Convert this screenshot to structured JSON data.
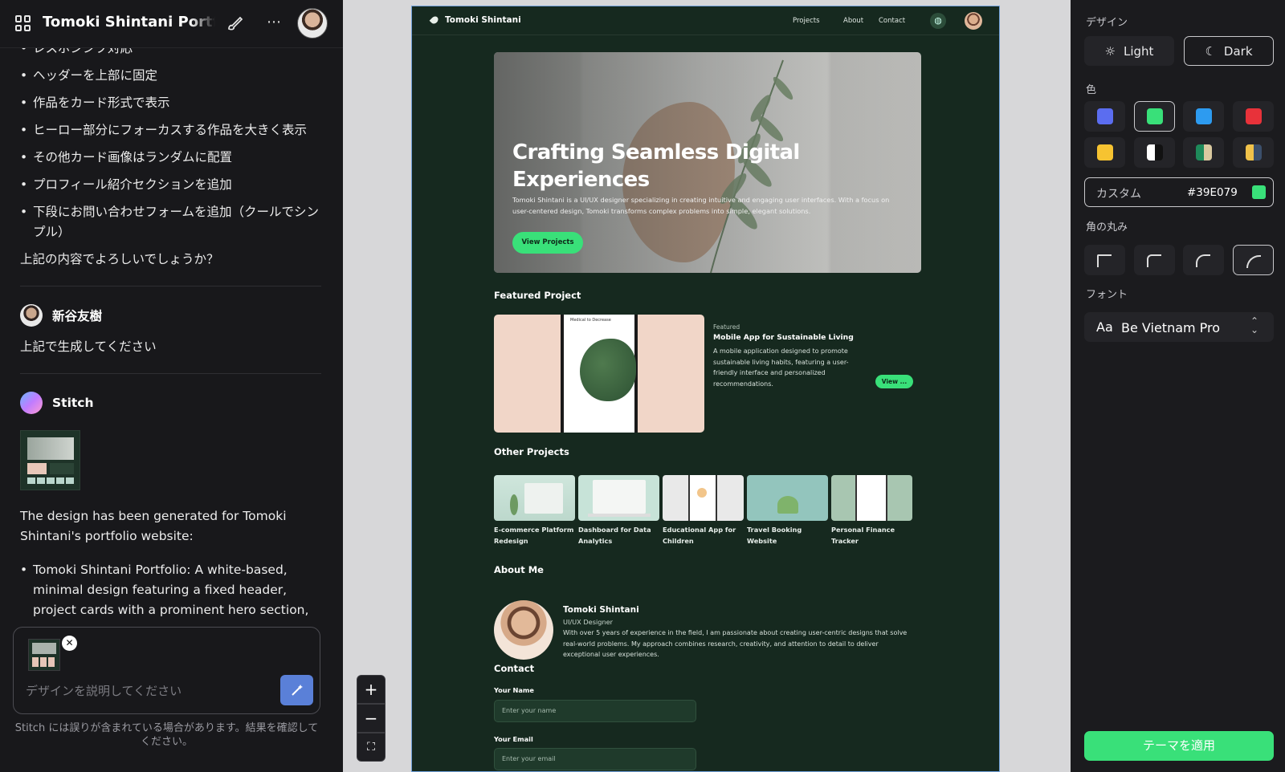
{
  "left": {
    "project_title": "Tomoki Shintani Portfolio",
    "bullets": [
      "レスポンシブ対応",
      "ヘッダーを上部に固定",
      "作品をカード形式で表示",
      "ヒーロー部分にフォーカスする作品を大きく表示",
      "その他カード画像はランダムに配置",
      "プロフィール紹介セクションを追加",
      "下段にお問い合わせフォームを追加（クールでシンプル）"
    ],
    "question": "上記の内容でよろしいでしょうか？",
    "user_name": "新谷友樹",
    "user_message": "上記で生成してください",
    "assistant_name": "Stitch",
    "reply": "The design has been generated for Tomoki Shintani's portfolio website:",
    "reply_bullet": "Tomoki Shintani Portfolio: A white-based, minimal design featuring a fixed header, project cards with a prominent hero section, randomly arranged cards, a profile introduction, and a",
    "input_placeholder": "デザインを説明してください",
    "disclaimer": "Stitch には誤りが含まれている場合があります。結果を確認してください。"
  },
  "mockup": {
    "brand": "Tomoki Shintani",
    "nav": [
      "Projects",
      "About",
      "Contact"
    ],
    "hero_title": "Crafting Seamless Digital Experiences",
    "hero_text": "Tomoki Shintani is a UI/UX designer specializing in creating intuitive and engaging user interfaces. With a focus on user-centered design, Tomoki transforms complex problems into simple, elegant solutions.",
    "hero_button": "View Projects",
    "featured_heading": "Featured Project",
    "featured_tag": "Featured",
    "featured_title": "Mobile App for Sustainable Living",
    "featured_desc": "A mobile application designed to promote sustainable living habits, featuring a user-friendly interface and personalized recommendations.",
    "featured_button": "View ...",
    "featured_phone_text": "Medical to Decrease",
    "other_heading": "Other Projects",
    "projects": [
      "E-commerce Platform Redesign",
      "Dashboard for Data Analytics",
      "Educational App for Children",
      "Travel Booking Website",
      "Personal Finance Tracker"
    ],
    "about_heading": "About Me",
    "about_name": "Tomoki Shintani",
    "about_role": "UI/UX Designer",
    "about_text": "With over 5 years of experience in the field, I am passionate about creating user-centric designs that solve real-world problems. My approach combines research, creativity, and attention to detail to deliver exceptional user experiences.",
    "contact_heading": "Contact",
    "name_label": "Your Name",
    "name_placeholder": "Enter your name",
    "email_label": "Your Email",
    "email_placeholder": "Enter your email"
  },
  "right": {
    "design_label": "デザイン",
    "light_label": "Light",
    "dark_label": "Dark",
    "color_label": "色",
    "custom_label": "カスタム",
    "custom_hex": "#39E079",
    "radius_label": "角の丸み",
    "font_label": "フォント",
    "font_prefix": "Aa",
    "font_name": "Be Vietnam Pro",
    "apply_label": "テーマを適用",
    "swatches": [
      "#5b6df0",
      "#39e079",
      "#2d9bf0",
      "#e8323a",
      "#f6c331",
      "#ffffff",
      "#1e8a5a",
      "#e0b257"
    ]
  },
  "colors": {
    "accent": "#39E079",
    "mockup_bg": "#16291f"
  }
}
